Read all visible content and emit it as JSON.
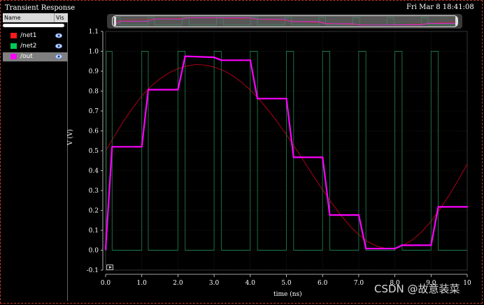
{
  "window": {
    "title": "Transient Response",
    "datetime": "Fri Mar 8 18:41:08"
  },
  "panel": {
    "col_name": "Name",
    "col_vis": "Vis",
    "items": [
      {
        "label": "/net1",
        "color": "#ff1a1a"
      },
      {
        "label": "/net2",
        "color": "#00cc55"
      },
      {
        "label": "/out",
        "color": "#ff00ff",
        "selected": true
      }
    ]
  },
  "watermark": "CSDN @故意装菜",
  "chart_data": {
    "type": "line",
    "xlabel": "time (ns)",
    "ylabel": "V (V)",
    "xlim": [
      0,
      10
    ],
    "ylim": [
      -0.1,
      1.1
    ],
    "xticks": [
      "0.0",
      "1.0",
      "2.0",
      "3.0",
      "4.0",
      "5.0",
      "6.0",
      "7.0",
      "8.0",
      "9.0",
      "10"
    ],
    "yticks": [
      "-0.1",
      "0.0",
      "0.1",
      "0.2",
      "0.3",
      "0.4",
      "0.5",
      "0.6",
      "0.7",
      "0.8",
      "0.9",
      "1.0",
      "1.1"
    ],
    "grid": true,
    "series": [
      {
        "name": "/net1",
        "color": "#c0001a",
        "style": "sine",
        "x": [
          0,
          0.25,
          0.5,
          0.75,
          1,
          1.25,
          1.5,
          1.75,
          2,
          2.25,
          2.5,
          2.75,
          3,
          3.25,
          3.5,
          3.75,
          4,
          4.25,
          4.5,
          4.75,
          5,
          5.25,
          5.5,
          5.75,
          6,
          6.25,
          6.5,
          6.75,
          7,
          7.25,
          7.5,
          7.75,
          8,
          8.25,
          8.5,
          8.75,
          9,
          9.25,
          9.5,
          9.75,
          10
        ],
        "y": [
          0.5,
          0.576,
          0.649,
          0.716,
          0.775,
          0.824,
          0.861,
          0.891,
          0.913,
          0.927,
          0.933,
          0.931,
          0.921,
          0.904,
          0.879,
          0.846,
          0.806,
          0.758,
          0.704,
          0.645,
          0.581,
          0.513,
          0.443,
          0.373,
          0.304,
          0.238,
          0.177,
          0.123,
          0.078,
          0.043,
          0.02,
          0.009,
          0.011,
          0.027,
          0.054,
          0.094,
          0.146,
          0.207,
          0.276,
          0.352,
          0.433
        ]
      },
      {
        "name": "/net2",
        "color": "#1f7a4a",
        "style": "step",
        "x": [
          0,
          0.02,
          0.02,
          0.18,
          0.18,
          1.0,
          1.0,
          1.18,
          1.18,
          2.0,
          2.0,
          2.2,
          2.2,
          3.0,
          3.0,
          3.2,
          3.2,
          4.0,
          4.0,
          4.2,
          4.2,
          5.0,
          5.0,
          5.2,
          5.2,
          6.0,
          6.0,
          6.2,
          6.2,
          7.0,
          7.0,
          7.2,
          7.2,
          8.0,
          8.0,
          8.2,
          8.2,
          9.0,
          9.0,
          9.2,
          9.2,
          10
        ],
        "y": [
          0,
          0,
          1,
          1,
          0,
          0,
          1,
          1,
          0,
          0,
          1,
          1,
          0,
          0,
          1,
          1,
          0,
          0,
          1,
          1,
          0,
          0,
          1,
          1,
          0,
          0,
          1,
          1,
          0,
          0,
          1,
          1,
          0,
          0,
          1,
          1,
          0,
          0,
          1,
          1,
          0,
          0
        ]
      },
      {
        "name": "/out",
        "color": "#ff00ff",
        "style": "line",
        "x": [
          0,
          0.18,
          1.0,
          1.18,
          2.0,
          2.2,
          3.0,
          3.2,
          4.0,
          4.2,
          5.0,
          5.2,
          6.0,
          6.2,
          7.0,
          7.2,
          8.0,
          8.2,
          9.0,
          9.2,
          10
        ],
        "y": [
          0.005,
          0.52,
          0.52,
          0.807,
          0.807,
          0.975,
          0.97,
          0.955,
          0.955,
          0.762,
          0.762,
          0.467,
          0.467,
          0.177,
          0.177,
          0.008,
          0.008,
          0.025,
          0.025,
          0.218,
          0.218
        ]
      }
    ]
  }
}
